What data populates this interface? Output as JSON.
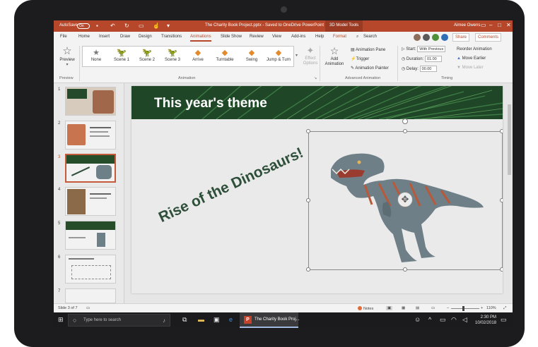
{
  "window": {
    "autosave_label": "AutoSave",
    "autosave_state": "On",
    "document_title": "The Charity Book Project.pptx - Saved to OneDrive PowerPoint",
    "context_tools": "3D Model Tools",
    "user_name": "Aimee Owens"
  },
  "menu": {
    "tabs": [
      "File",
      "Home",
      "Insert",
      "Draw",
      "Design",
      "Transitions",
      "Animations",
      "Slide Show",
      "Review",
      "View",
      "Add-ins",
      "Help",
      "Format"
    ],
    "active_tab": "Animations",
    "search_label": "Search",
    "share_label": "Share",
    "comments_label": "Comments"
  },
  "ribbon": {
    "preview_label": "Preview",
    "preview_group": "Preview",
    "animations": [
      {
        "label": "None",
        "icon": "star-icon"
      },
      {
        "label": "Scene 1",
        "icon": "dinosaur-icon"
      },
      {
        "label": "Scene 2",
        "icon": "dinosaur-icon"
      },
      {
        "label": "Scene 3",
        "icon": "dinosaur-icon"
      },
      {
        "label": "Arrive",
        "icon": "cube-icon"
      },
      {
        "label": "Turntable",
        "icon": "cube-icon"
      },
      {
        "label": "Swing",
        "icon": "cube-icon"
      },
      {
        "label": "Jump & Turn",
        "icon": "cube-icon"
      }
    ],
    "effect_options_label": "Effect Options",
    "animation_group": "Animation",
    "add_animation_label": "Add Animation",
    "animation_pane_label": "Animation Pane",
    "trigger_label": "Trigger",
    "animation_painter_label": "Animation Painter",
    "advanced_group": "Advanced Animation",
    "start_label": "Start:",
    "start_value": "With Previous",
    "duration_label": "Duration:",
    "duration_value": "01.00",
    "delay_label": "Delay:",
    "delay_value": "00.00",
    "reorder_label": "Reorder Animation",
    "move_earlier_label": "Move Earlier",
    "move_later_label": "Move Later",
    "timing_group": "Timing"
  },
  "slides": [
    {
      "number": "1"
    },
    {
      "number": "2"
    },
    {
      "number": "3"
    },
    {
      "number": "4"
    },
    {
      "number": "5"
    },
    {
      "number": "6"
    },
    {
      "number": "7"
    }
  ],
  "slide": {
    "title": "This year's theme",
    "subtitle": "Rise of the Dinosaurs!"
  },
  "statusbar": {
    "slide_counter": "Slide 3 of 7",
    "notes_label": "Notes",
    "zoom": "110%"
  },
  "taskbar": {
    "search_placeholder": "Type here to search",
    "app_label": "The Charity Book Proj...",
    "time": "2:30 PM",
    "date": "10/02/2018"
  },
  "colors": {
    "accent": "#b7472a",
    "banner": "#1f4727",
    "subtitle_text": "#2e4f3a"
  }
}
